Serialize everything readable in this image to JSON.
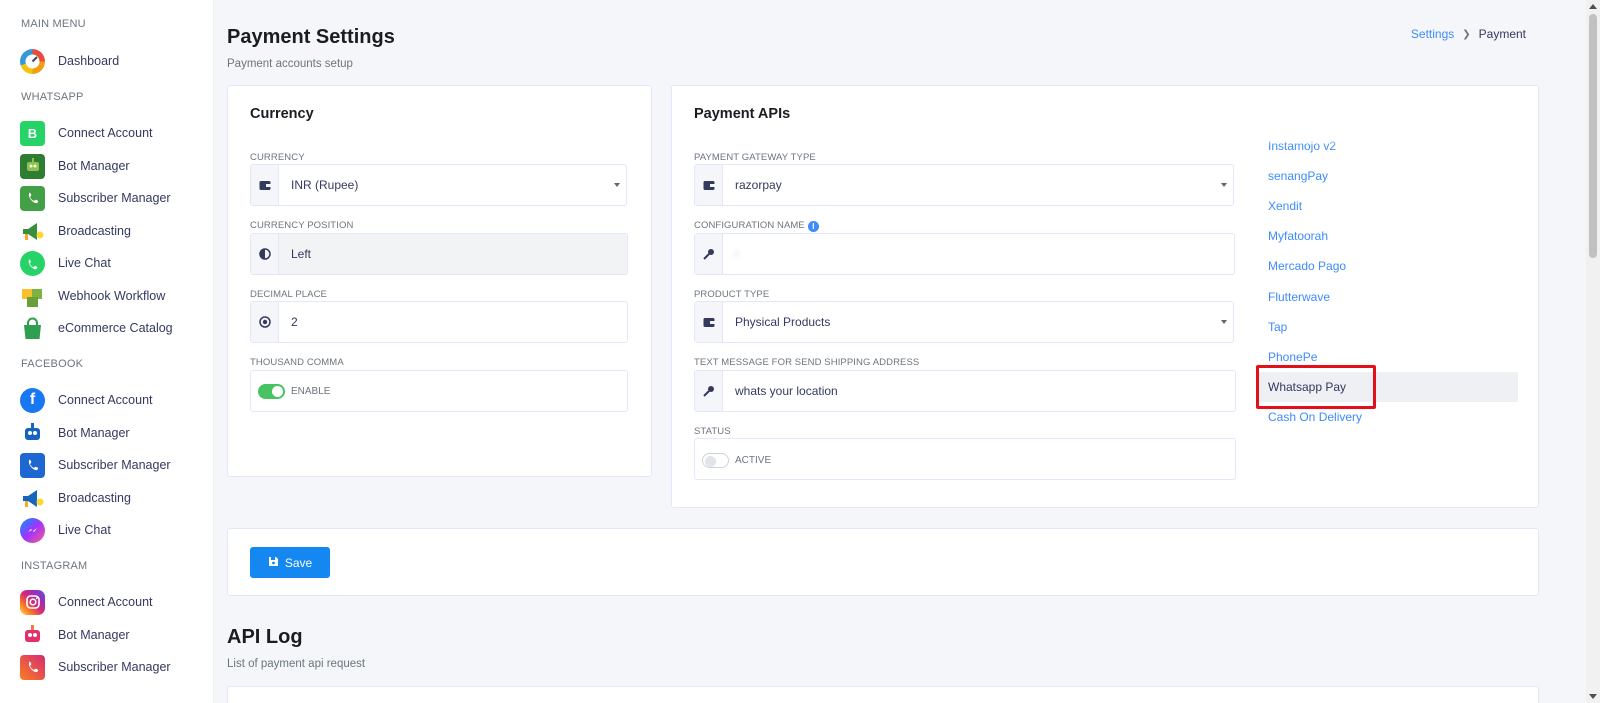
{
  "sidebar": {
    "sections": [
      {
        "header": "MAIN MENU",
        "items": [
          {
            "label": "Dashboard",
            "icon": "dashboard-gauge-icon"
          }
        ]
      },
      {
        "header": "WHATSAPP",
        "items": [
          {
            "label": "Connect Account",
            "icon": "whatsapp-business-icon"
          },
          {
            "label": "Bot Manager",
            "icon": "robot-icon"
          },
          {
            "label": "Subscriber Manager",
            "icon": "contacts-book-icon"
          },
          {
            "label": "Broadcasting",
            "icon": "megaphone-icon"
          },
          {
            "label": "Live Chat",
            "icon": "whatsapp-icon"
          },
          {
            "label": "Webhook Workflow",
            "icon": "puzzle-icon"
          },
          {
            "label": "eCommerce Catalog",
            "icon": "shopping-bag-icon"
          }
        ]
      },
      {
        "header": "FACEBOOK",
        "items": [
          {
            "label": "Connect Account",
            "icon": "facebook-icon"
          },
          {
            "label": "Bot Manager",
            "icon": "robot-icon"
          },
          {
            "label": "Subscriber Manager",
            "icon": "contacts-book-icon"
          },
          {
            "label": "Broadcasting",
            "icon": "megaphone-icon"
          },
          {
            "label": "Live Chat",
            "icon": "messenger-icon"
          }
        ]
      },
      {
        "header": "INSTAGRAM",
        "items": [
          {
            "label": "Connect Account",
            "icon": "instagram-icon"
          },
          {
            "label": "Bot Manager",
            "icon": "robot-icon"
          },
          {
            "label": "Subscriber Manager",
            "icon": "contacts-book-icon"
          }
        ]
      }
    ]
  },
  "header": {
    "title": "Payment Settings",
    "subtitle": "Payment accounts setup",
    "breadcrumb": {
      "link": "Settings",
      "current": "Payment"
    }
  },
  "currency_card": {
    "title": "Currency",
    "currency": {
      "label": "CURRENCY",
      "value": "INR (Rupee)"
    },
    "position": {
      "label": "CURRENCY POSITION",
      "value": "Left"
    },
    "decimal": {
      "label": "DECIMAL PLACE",
      "value": "2"
    },
    "thousand_comma": {
      "label": "THOUSAND COMMA",
      "toggle_label": "ENABLE",
      "checked": true
    }
  },
  "payment_card": {
    "title": "Payment APIs",
    "gateway_type": {
      "label": "PAYMENT GATEWAY TYPE",
      "value": "razorpay"
    },
    "config_name": {
      "label": "CONFIGURATION NAME",
      "value": "r"
    },
    "product_type": {
      "label": "PRODUCT TYPE",
      "value": "Physical Products"
    },
    "shipping_msg": {
      "label": "TEXT MESSAGE FOR SEND SHIPPING ADDRESS",
      "value": "whats your location"
    },
    "status": {
      "label": "STATUS",
      "toggle_label": "ACTIVE",
      "checked": false
    },
    "gateways": [
      "Instamojo v2",
      "senangPay",
      "Xendit",
      "Myfatoorah",
      "Mercado Pago",
      "Flutterwave",
      "Tap",
      "PhonePe",
      "Whatsapp Pay",
      "Cash On Delivery"
    ],
    "active_gateway": "Whatsapp Pay"
  },
  "actions": {
    "save_label": "Save"
  },
  "api_log": {
    "title": "API Log",
    "subtitle": "List of payment api request"
  },
  "colors": {
    "primary": "#1488f0",
    "link": "#3d8bfd",
    "success": "#47c363",
    "highlight": "#e3101a"
  }
}
